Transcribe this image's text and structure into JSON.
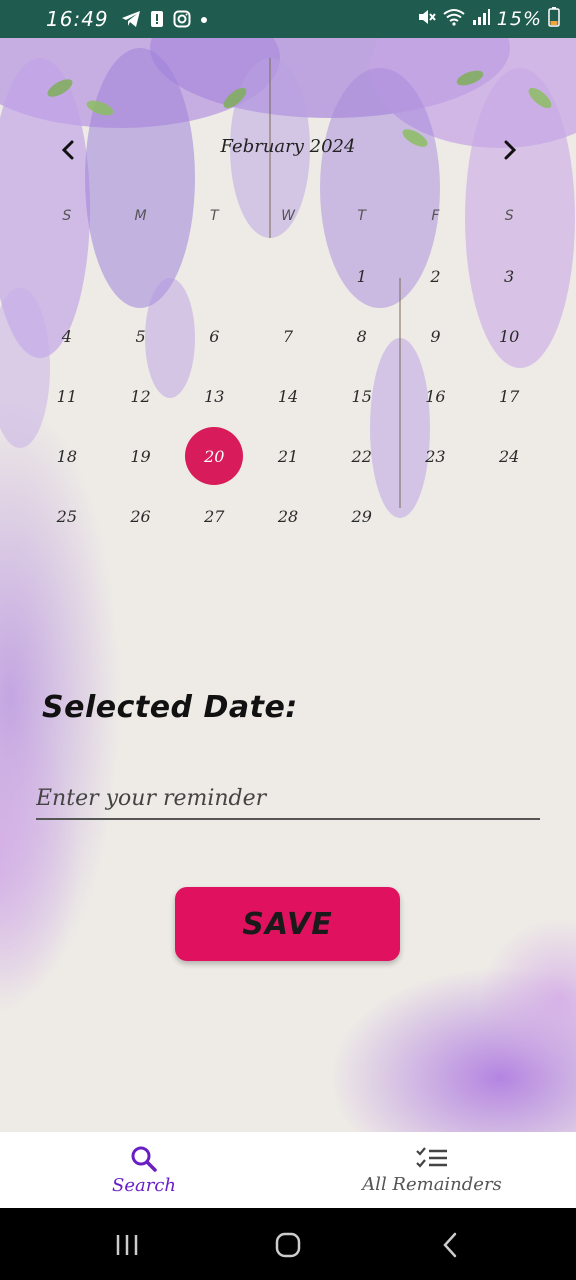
{
  "status_bar": {
    "time": "16:49",
    "battery_percent": "15%",
    "left_icons": [
      "telegram-icon",
      "notification-icon",
      "instagram-icon",
      "dot-icon"
    ],
    "right_icons": [
      "mute-icon",
      "wifi-icon",
      "signal-icon",
      "battery-icon"
    ],
    "background_color": "#1f5b4e"
  },
  "calendar": {
    "month_label": "February 2024",
    "weekdays": [
      "S",
      "M",
      "T",
      "W",
      "T",
      "F",
      "S"
    ],
    "weeks": [
      [
        "",
        "",
        "",
        "",
        "1",
        "2",
        "3"
      ],
      [
        "4",
        "5",
        "6",
        "7",
        "8",
        "9",
        "10"
      ],
      [
        "11",
        "12",
        "13",
        "14",
        "15",
        "16",
        "17"
      ],
      [
        "18",
        "19",
        "20",
        "21",
        "22",
        "23",
        "24"
      ],
      [
        "25",
        "26",
        "27",
        "28",
        "29",
        "",
        ""
      ]
    ],
    "selected_day": "20",
    "selected_color": "#d81b5a"
  },
  "form": {
    "selected_date_label": "Selected Date:",
    "reminder_placeholder": "Enter your reminder",
    "reminder_value": "",
    "save_label": "SAVE",
    "save_color": "#e0115f"
  },
  "bottom_nav": {
    "items": [
      {
        "label": "Search",
        "icon": "search-icon",
        "active": true
      },
      {
        "label": "All Remainders",
        "icon": "checklist-icon",
        "active": false
      }
    ],
    "active_color": "#6a1fc4"
  },
  "system_nav": {
    "buttons": [
      "recent-apps-icon",
      "home-icon",
      "back-icon"
    ]
  }
}
